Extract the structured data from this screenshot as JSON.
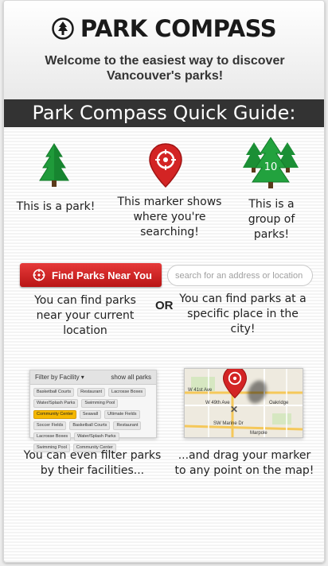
{
  "header": {
    "app_title": "PARK COMPASS",
    "welcome": "Welcome to the easiest way to discover Vancouver's parks!"
  },
  "guide": {
    "title": "Park Compass Quick Guide:",
    "park_caption": "This is a park!",
    "marker_caption": "This marker shows where you're searching!",
    "group_caption": "This is a group of parks!",
    "group_count": "10"
  },
  "find": {
    "button_label": "Find Parks Near You",
    "search_placeholder": "search for an address or location",
    "or_label": "OR",
    "near_caption": "You can find parks near your current location",
    "place_caption": "You can find parks at a specific place in the city!"
  },
  "filter": {
    "header_label": "Filter by Facility",
    "show_all": "show all parks",
    "chips": [
      "Basketball Courts",
      "Restaurant",
      "Lacrosse Boxes",
      "Water/Splash Parks",
      "Swimming Pool",
      "Community Center",
      "Seawall",
      "Ultimate Fields",
      "Soccer Fields",
      "Basketball Courts",
      "Restaurant",
      "Lacrosse Boxes",
      "Water/Splash Parks",
      "Swimming Pool",
      "Community Center"
    ],
    "active_chip_index": 5,
    "caption": "You can even filter parks by their facilities..."
  },
  "map": {
    "labels": [
      "W 41st Ave",
      "W 49th Ave",
      "Oakridge",
      "SW Marine Dr",
      "Marpole"
    ],
    "caption": "...and drag your marker to any point on the map!"
  },
  "colors": {
    "accent_red": "#d32424",
    "tree_green": "#1e9b3a",
    "guide_bar": "#333333"
  }
}
